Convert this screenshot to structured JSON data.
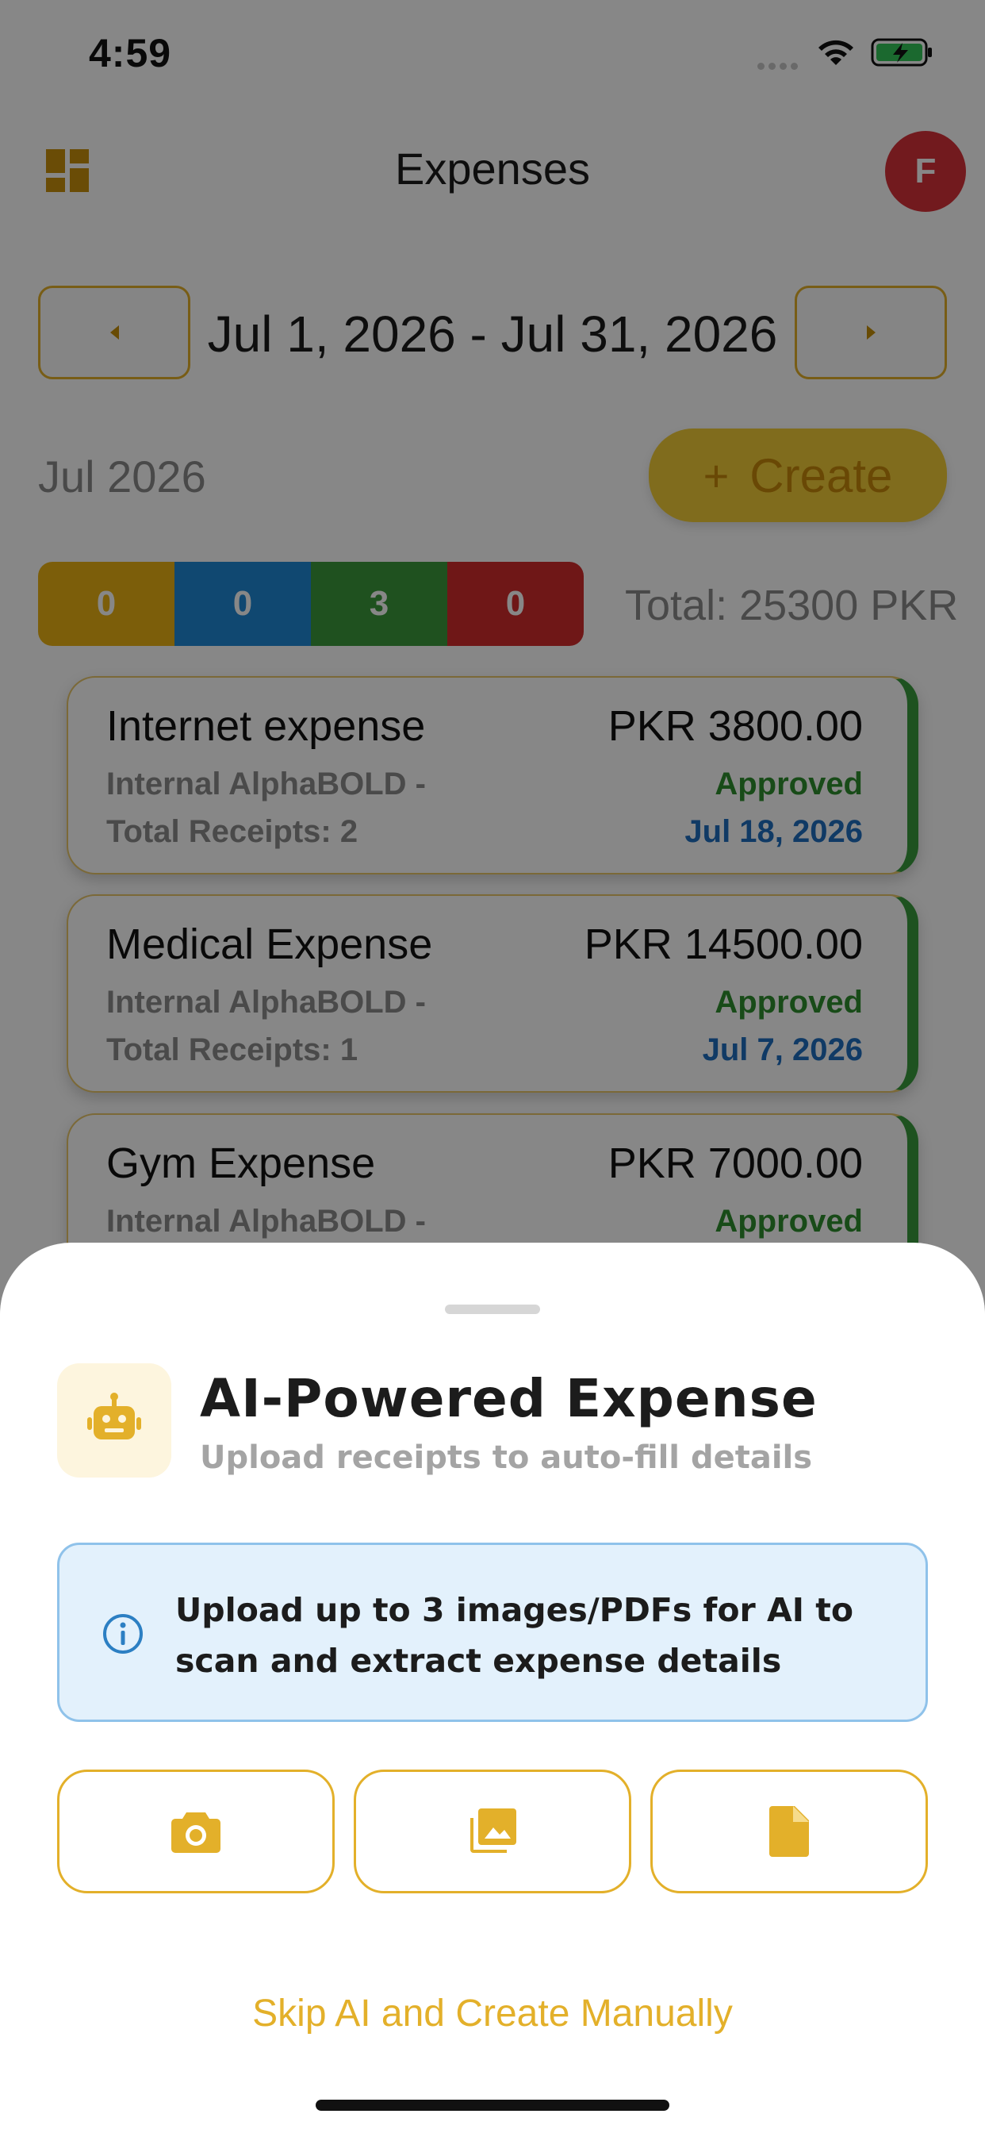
{
  "status_bar": {
    "time": "4:59"
  },
  "header": {
    "title": "Expenses",
    "avatar_initial": "F"
  },
  "date_range": {
    "label": "Jul 1, 2026 - Jul 31, 2026"
  },
  "month_label": "Jul 2026",
  "create_button": {
    "label": "Create",
    "plus": "+"
  },
  "status_counts": [
    {
      "value": "0",
      "color": "#ebb213"
    },
    {
      "value": "0",
      "color": "#1f88d6"
    },
    {
      "value": "3",
      "color": "#3c9a3c"
    },
    {
      "value": "0",
      "color": "#d22c2c"
    }
  ],
  "total_label": "Total: 25300 PKR",
  "expenses": [
    {
      "title": "Internet expense",
      "amount": "PKR 3800.00",
      "org": "Internal AlphaBOLD -",
      "status": "Approved",
      "receipts": "Total Receipts: 2",
      "date": "Jul 18, 2026"
    },
    {
      "title": "Medical Expense",
      "amount": "PKR 14500.00",
      "org": "Internal AlphaBOLD -",
      "status": "Approved",
      "receipts": "Total Receipts: 1",
      "date": "Jul 7, 2026"
    },
    {
      "title": "Gym Expense",
      "amount": "PKR 7000.00",
      "org": "Internal AlphaBOLD -",
      "status": "Approved"
    }
  ],
  "sheet": {
    "title": "AI-Powered Expense",
    "subtitle": "Upload receipts to auto-fill details",
    "info": "Upload up to 3 images/PDFs for AI to scan and extract expense details",
    "upload_options": [
      {
        "icon": "camera-icon"
      },
      {
        "icon": "gallery-icon"
      },
      {
        "icon": "document-icon"
      }
    ],
    "skip_label": "Skip AI and Create Manually"
  },
  "colors": {
    "accent": "#e3b02a",
    "approved": "#2f8f2f",
    "date": "#1f6fbf",
    "avatar": "#d8323a",
    "info_bg": "#e3f1fc"
  }
}
